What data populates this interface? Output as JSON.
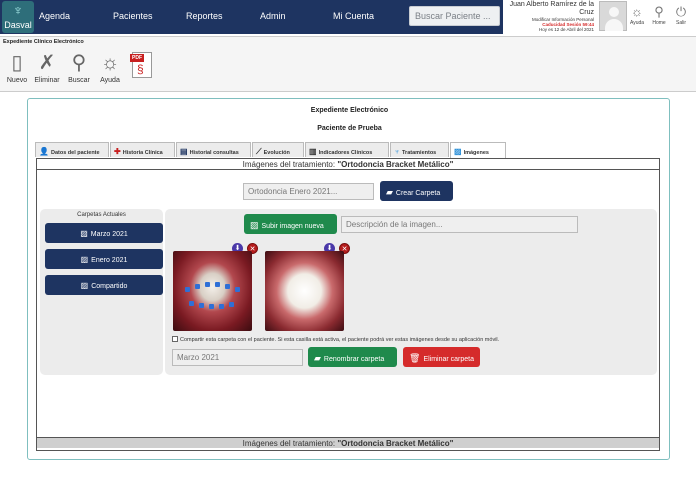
{
  "app": {
    "logo_text": "Dasval"
  },
  "nav": [
    {
      "label": "Agenda"
    },
    {
      "label": "Pacientes"
    },
    {
      "label": "Reportes"
    },
    {
      "label": "Admin"
    },
    {
      "label": "Mi Cuenta"
    }
  ],
  "search": {
    "placeholder": "Buscar Paciente ..."
  },
  "user": {
    "name": "Juan Alberto Ramírez de la Cruz",
    "modify": "Modificar Información Personal",
    "session": "Caducidad Sesión 59:44",
    "date": "Hoy es 12 de Abril del 2021"
  },
  "top_actions": [
    {
      "label": "Ayuda",
      "icon": "lightbulb-icon"
    },
    {
      "label": "Home",
      "icon": "lamp-icon"
    },
    {
      "label": "Salir",
      "icon": "power-icon"
    }
  ],
  "toolbar": {
    "title": "Expediente Clínico Electrónico",
    "items": [
      {
        "label": "Nuevo",
        "icon": "new-document-icon"
      },
      {
        "label": "Eliminar",
        "icon": "delete-x-icon"
      },
      {
        "label": "Buscar",
        "icon": "magnifier-icon"
      },
      {
        "label": "Ayuda",
        "icon": "lightbulb-icon"
      },
      {
        "label": "",
        "icon": "pdf-icon",
        "badge": "PDF"
      }
    ]
  },
  "record": {
    "title": "Expediente Electrónico",
    "patient": "Paciente de Prueba"
  },
  "tabs": [
    {
      "label": "Datos del paciente",
      "icon": "person-icon"
    },
    {
      "label": "Historia Clínica",
      "icon": "medkit-icon"
    },
    {
      "label": "Historial consultas",
      "icon": "document-icon"
    },
    {
      "label": "Evolución",
      "icon": "line-chart-icon"
    },
    {
      "label": "Indicadores Clínicos",
      "icon": "bar-chart-icon"
    },
    {
      "label": "Tratamientos",
      "icon": "tooth-icon"
    },
    {
      "label": "Imágenes",
      "icon": "images-icon",
      "active": true
    }
  ],
  "treatment": {
    "prefix": "Imágenes del tratamiento: ",
    "name": "\"Ortodoncia Bracket Metálico\""
  },
  "new_folder": {
    "placeholder": "Ortodoncia Enero 2021...",
    "button": "Crear Carpeta"
  },
  "folders": {
    "title": "Carpetas Actuales",
    "items": [
      {
        "label": "Marzo 2021"
      },
      {
        "label": "Enero 2021"
      },
      {
        "label": "Compartido"
      }
    ]
  },
  "upload": {
    "button": "Subir imagen nueva",
    "placeholder": "Descripción de la imagen..."
  },
  "share": {
    "text": "Compartir esta carpeta con el paciente. Si esta casilla está activa, el paciente podrá ver estas imágenes desde su aplicación móvil."
  },
  "folder_edit": {
    "value": "Marzo 2021",
    "rename_button": "Renombrar carpeta",
    "delete_button": "Eliminar carpeta"
  },
  "colors": {
    "navy": "#1e3461",
    "green": "#1f8a4c",
    "red": "#d52b2b",
    "teal_border": "#7fbfbf"
  }
}
